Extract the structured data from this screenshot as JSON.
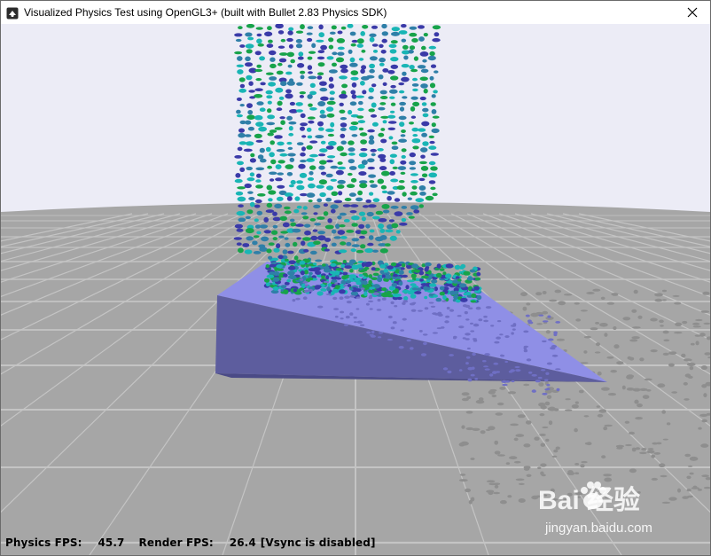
{
  "window": {
    "title": "Visualized Physics Test using OpenGL3+ (built with Bullet 2.83 Physics SDK)"
  },
  "status": {
    "physics_label": "Physics FPS:",
    "physics_value": "45.7",
    "render_label": "Render FPS:",
    "render_value": "26.4",
    "vsync_note": "[Vsync is disabled]"
  },
  "watermark": {
    "brand": "Bai  经验",
    "url": "jingyan.baidu.com"
  },
  "scene": {
    "sky_color": "#ececf6",
    "ground_color": "#a6a6a6",
    "grid_color": "#c4c4c4",
    "ramp_top_color": "#8f8fe6",
    "ramp_front_color": "#5d5d9e",
    "particle_colors": [
      "#3a3aa8",
      "#17a34a",
      "#19b5b5",
      "#2f7fa8"
    ]
  }
}
